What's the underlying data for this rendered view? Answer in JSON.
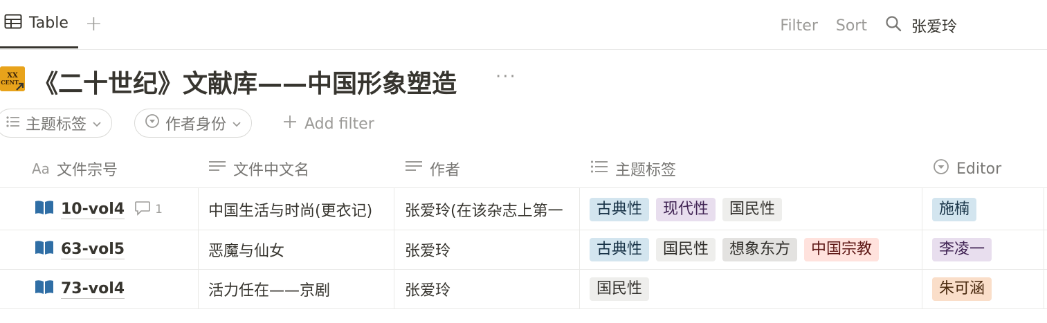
{
  "view": {
    "tab_label": "Table",
    "add_view": "+"
  },
  "toolbar": {
    "filter": "Filter",
    "sort": "Sort",
    "search_value": "张爱玲"
  },
  "page": {
    "title": "《二十世纪》文献库——中国形象塑造",
    "more": "···",
    "logo_text": "XX CENT"
  },
  "filters": {
    "items": [
      {
        "label": "主题标签"
      },
      {
        "label": "作者身份"
      }
    ],
    "add_label": "Add filter"
  },
  "columns": [
    {
      "label": "文件宗号",
      "icon": "Aa"
    },
    {
      "label": "文件中文名",
      "icon": "text-icon"
    },
    {
      "label": "作者",
      "icon": "text-icon"
    },
    {
      "label": "主题标签",
      "icon": "list-icon"
    },
    {
      "label": "Editor",
      "icon": "select-icon"
    }
  ],
  "rows": [
    {
      "id": "10-vol4",
      "comments": "1",
      "name": "中国生活与时尚(更衣记)",
      "author": "张爱玲(在该杂志上第一",
      "tags": [
        {
          "label": "古典性",
          "color": "blue"
        },
        {
          "label": "现代性",
          "color": "purple"
        },
        {
          "label": "国民性",
          "color": "gray"
        }
      ],
      "editor": {
        "label": "施楠",
        "color": "blue"
      }
    },
    {
      "id": "63-vol5",
      "name": "恶魔与仙女",
      "author": "张爱玲",
      "tags": [
        {
          "label": "古典性",
          "color": "blue"
        },
        {
          "label": "国民性",
          "color": "gray"
        },
        {
          "label": "想象东方",
          "color": "darkgray"
        },
        {
          "label": "中国宗教",
          "color": "red"
        }
      ],
      "editor": {
        "label": "李凌一",
        "color": "purple"
      }
    },
    {
      "id": "73-vol4",
      "name": "活力任在——京剧",
      "author": "张爱玲",
      "tags": [
        {
          "label": "国民性",
          "color": "gray"
        }
      ],
      "editor": {
        "label": "朱可涵",
        "color": "orange"
      }
    }
  ]
}
